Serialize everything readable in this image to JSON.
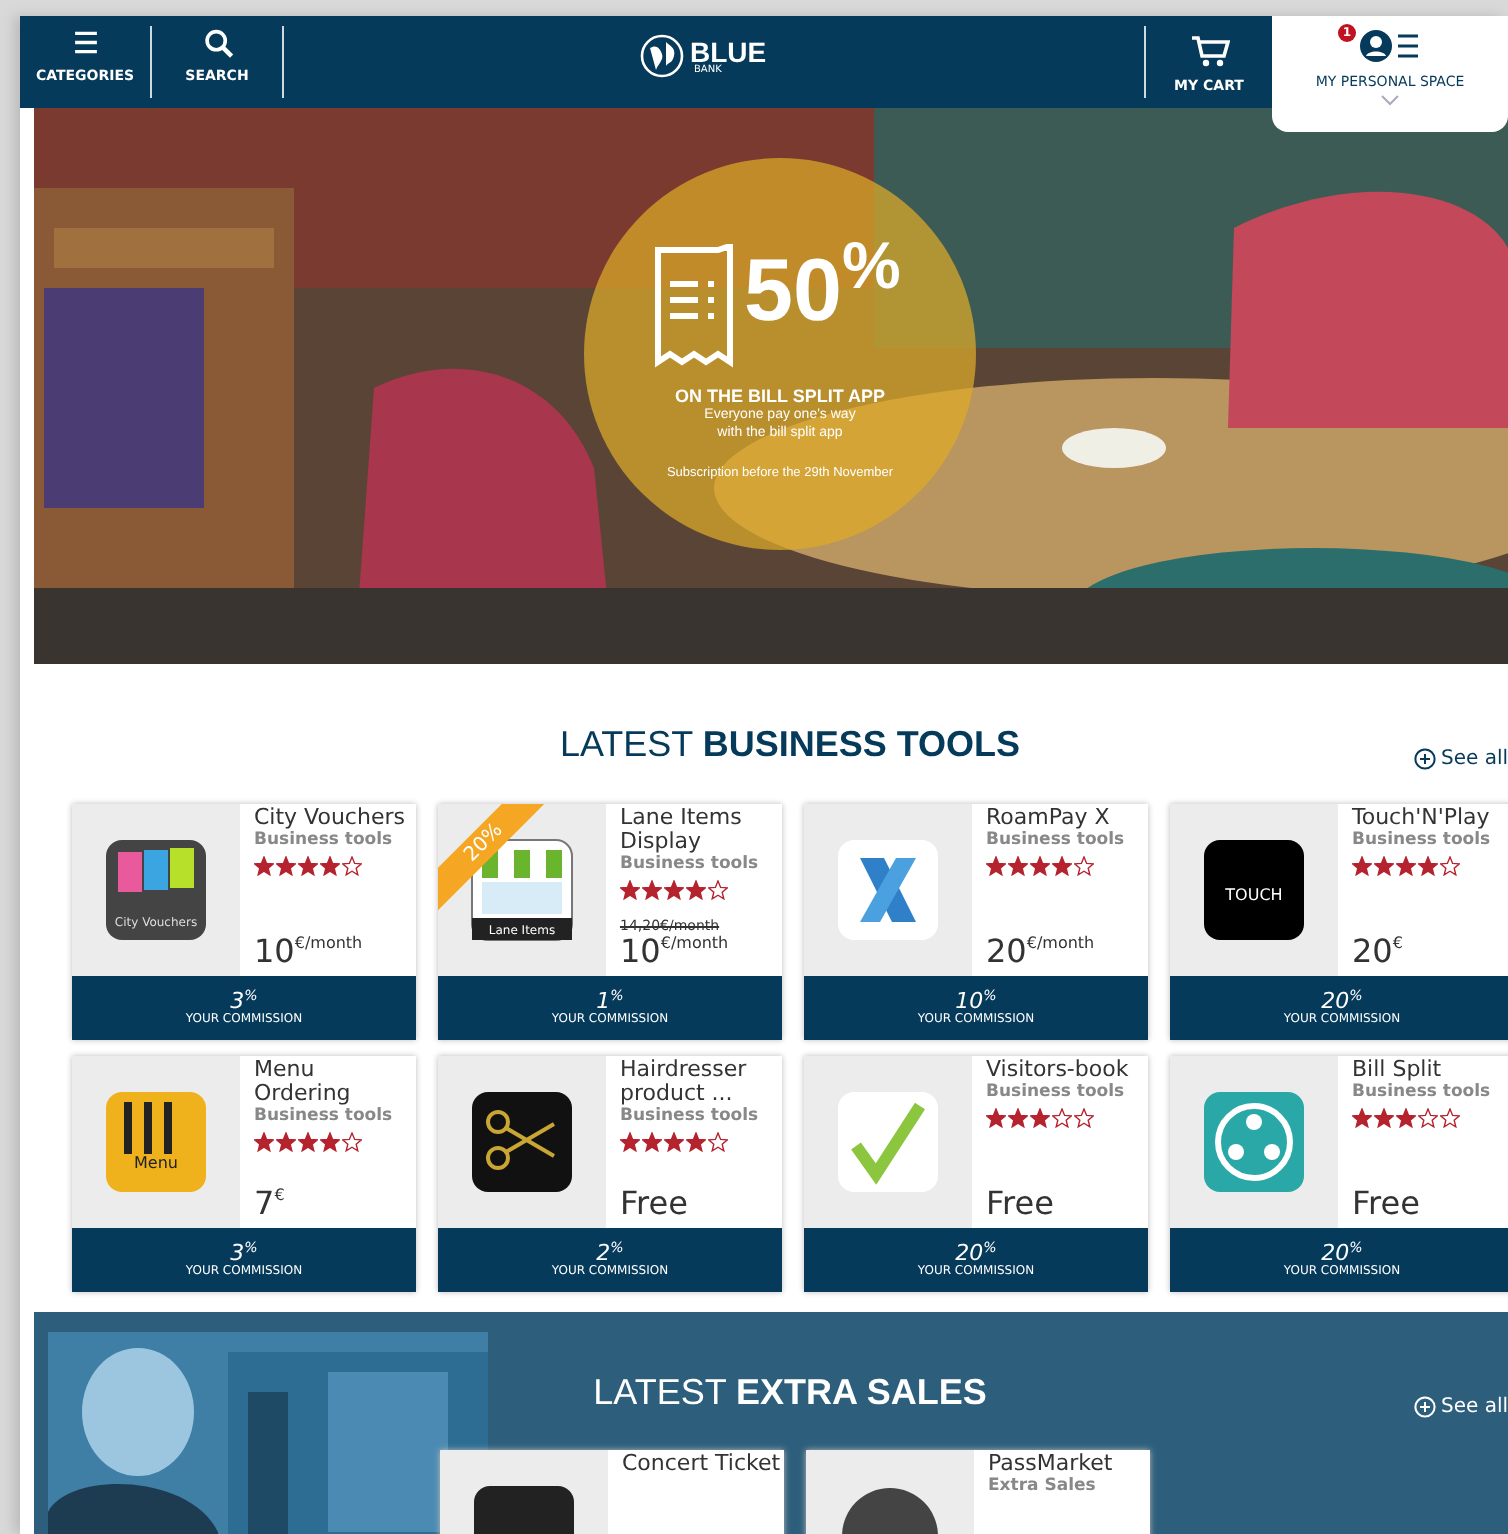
{
  "header": {
    "nav_left": [
      {
        "kind": "menu",
        "label": "CATEGORIES"
      },
      {
        "kind": "search",
        "label": "SEARCH"
      }
    ],
    "logo": {
      "name": "BLUE",
      "sub": "BANK"
    },
    "cart": {
      "label": "MY CART"
    },
    "personal": {
      "label": "MY PERSONAL SPACE",
      "badge": "1"
    }
  },
  "hero": {
    "kind": "picture",
    "discount": "50",
    "unit": "%",
    "headline": "ON THE BILL SPLIT APP",
    "line_1": "Everyone pay one's way",
    "line_2": "with the bill split app",
    "note": "Subscription before the 29th November"
  },
  "sections": [
    {
      "kind": "light",
      "title": "LATEST **BUSINESS TOOLS**",
      "see_all": "See all",
      "products": [
        {
          "kind": "vouchers",
          "logo_text": "City Vouchers",
          "name": "City Vouchers",
          "category": "Business tools",
          "stars": 4,
          "price": "10$^{€/month}$",
          "commission": "3$^{%}$",
          "commission_label": "YOUR COMMISSION"
        },
        {
          "kind": "awning",
          "logo_text": "Lane Items",
          "ribbon": "20%",
          "name": "Lane Items Display",
          "category": "Business tools",
          "stars": 4,
          "old_price": "14,20€/month",
          "price": "10$^{€/month}$",
          "commission": "1$^{%}$",
          "commission_label": "YOUR COMMISSION"
        },
        {
          "kind": "x",
          "name": "RoamPay X",
          "category": "Business tools",
          "stars": 4,
          "price": "20$^{€/month}$",
          "commission": "10$^{%}$",
          "commission_label": "YOUR COMMISSION"
        },
        {
          "kind": "touch",
          "logo_text": "TOUCH",
          "name": "Touch'N'Play",
          "category": "Business tools",
          "stars": 4,
          "price": "20$^{€}$",
          "commission": "20$^{%}$",
          "commission_label": "YOUR COMMISSION"
        },
        {
          "kind": "menu",
          "logo_text": "Menu",
          "name": "Menu Ordering",
          "category": "Business tools",
          "stars": 4,
          "price": "7$^{€}$",
          "commission": "3$^{%}$",
          "commission_label": "YOUR COMMISSION"
        },
        {
          "kind": "scissors",
          "name": "Hairdresser product ...",
          "category": "Business tools",
          "stars": 4,
          "price": "Free",
          "commission": "2$^{%}$",
          "commission_label": "YOUR COMMISSION"
        },
        {
          "kind": "check",
          "name": "Visitors-book",
          "category": "Business tools",
          "stars": 3,
          "price": "Free",
          "commission": "20$^{%}$",
          "commission_label": "YOUR COMMISSION"
        },
        {
          "kind": "people",
          "name": "Bill Split",
          "category": "Business tools",
          "stars": 3,
          "price": "Free",
          "commission": "20$^{%}$",
          "commission_label": "YOUR COMMISSION"
        }
      ]
    },
    {
      "kind": "dark",
      "title": "LATEST **EXTRA SALES**",
      "see_all": "See all",
      "products": [
        {
          "kind": "ticket",
          "name": "Concert Ticket"
        },
        {
          "kind": "circle",
          "name": "PassMarket",
          "category": "Extra Sales"
        }
      ]
    }
  ]
}
